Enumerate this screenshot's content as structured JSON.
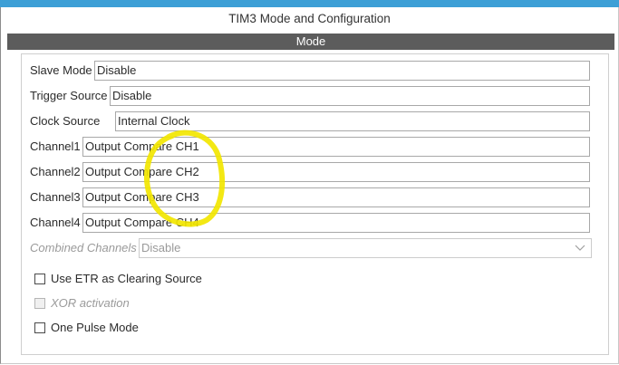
{
  "window": {
    "title": "TIM3 Mode and Configuration"
  },
  "section": {
    "title": "Mode"
  },
  "fields": {
    "slave_mode": {
      "label": "Slave Mode",
      "value": "Disable"
    },
    "trigger_source": {
      "label": "Trigger Source",
      "value": "Disable"
    },
    "clock_source": {
      "label": "Clock Source",
      "value": "Internal Clock"
    },
    "channel1": {
      "label": "Channel1",
      "value": "Output Compare CH1"
    },
    "channel2": {
      "label": "Channel2",
      "value": "Output Compare CH2"
    },
    "channel3": {
      "label": "Channel3",
      "value": "Output Compare CH3"
    },
    "channel4": {
      "label": "Channel4",
      "value": "Output Compare CH4"
    },
    "combined_channels": {
      "label": "Combined Channels",
      "value": "Disable"
    }
  },
  "checkboxes": {
    "use_etr": {
      "label": "Use ETR as Clearing Source",
      "checked": false,
      "enabled": true
    },
    "xor_activation": {
      "label": "XOR activation",
      "checked": false,
      "enabled": false
    },
    "one_pulse_mode": {
      "label": "One Pulse Mode",
      "checked": false,
      "enabled": true
    }
  },
  "colors": {
    "accent_strip": "#3d9fd6",
    "section_bar": "#5c5c5c",
    "highlight_circle": "#f2e600"
  },
  "icons": {
    "dropdown": "chevron-down-icon"
  }
}
